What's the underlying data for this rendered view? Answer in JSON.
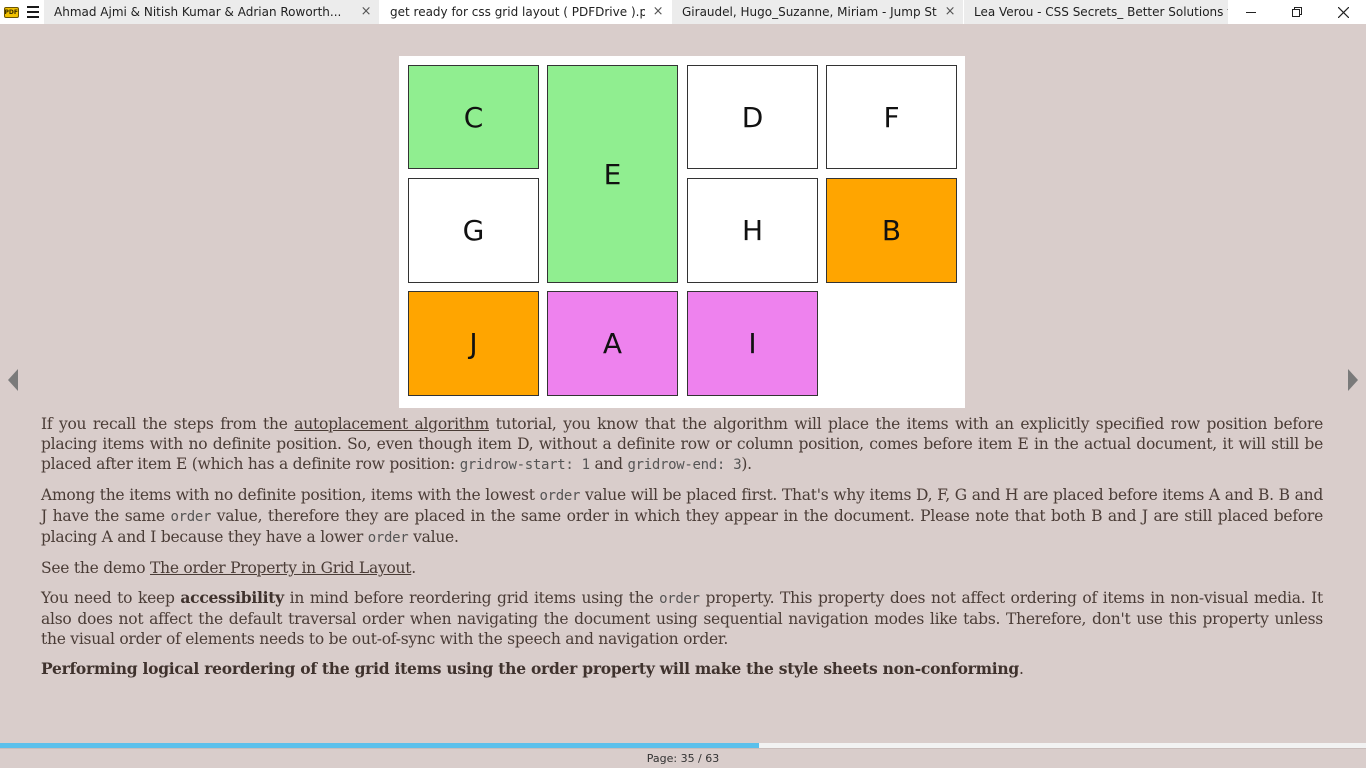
{
  "app": {
    "logo_text": "PDF"
  },
  "tabs": [
    {
      "label": "Ahmad Ajmi & Nitish Kumar & Adrian Roworth...",
      "active": false
    },
    {
      "label": "get ready for css grid layout ( PDFDrive ).pdf",
      "active": true
    },
    {
      "label": "Giraudel, Hugo_Suzanne, Miriam - Jump Start S...",
      "active": false
    },
    {
      "label": "Lea Verou - CSS Secrets_ Better Solutions to Ev...",
      "active": false
    }
  ],
  "tab_close_glyph": "×",
  "colors": {
    "green": "#90ee90",
    "white": "#ffffff",
    "orange": "#ffa500",
    "violet": "#ee82ee",
    "progress": "#5bc0eb",
    "background": "#d9cdcb"
  },
  "grid_items": {
    "c": "C",
    "e": "E",
    "d": "D",
    "f": "F",
    "g": "G",
    "h": "H",
    "b": "B",
    "j": "J",
    "a": "A",
    "i": "I"
  },
  "para1": {
    "t1": "If you recall the steps from the ",
    "link": "autoplacement algorithm",
    "t2": " tutorial, you know that the algorithm will place the items with an explicitly specified row position before placing items with no definite position. So, even though item D, without a definite row or column position, comes before item E in the actual document, it will still be placed after item E (which has a definite row position: ",
    "code1": "gridrow-start: 1",
    "t3": " and ",
    "code2": "gridrow-end: 3",
    "t4": ")."
  },
  "para2": {
    "t1": "Among the items with no definite position, items with the lowest ",
    "code1": "order",
    "t2": " value will be placed first. That's why items D, F, G and H are placed before items A and B. B and J have the same ",
    "code2": "order",
    "t3": " value, therefore they are placed in the same order in which they appear in the document. Please note that both B and J are still placed before placing A and I because they have a lower ",
    "code3": "order",
    "t4": " value."
  },
  "para3": {
    "t1": "See the demo ",
    "link": "The order Property in Grid Layout",
    "t2": "."
  },
  "para4": {
    "t1": "You need to keep ",
    "bold": "accessibility",
    "t2": " in mind before reordering grid items using the ",
    "code1": "order",
    "t3": " property. This property does not affect ordering of items in non-visual media. It also does not affect the default traversal order when navigating the document using sequential navigation modes like tabs. Therefore, don't use this property unless the visual order of elements needs to be out-of-sync with the speech and navigation order."
  },
  "para5": {
    "bold": "Performing logical reordering of the grid items using the order property will make the style sheets non-conforming",
    "t1": "."
  },
  "progress": {
    "fraction": 0.5556
  },
  "footer": {
    "page_label": "Page: 35 / 63"
  }
}
